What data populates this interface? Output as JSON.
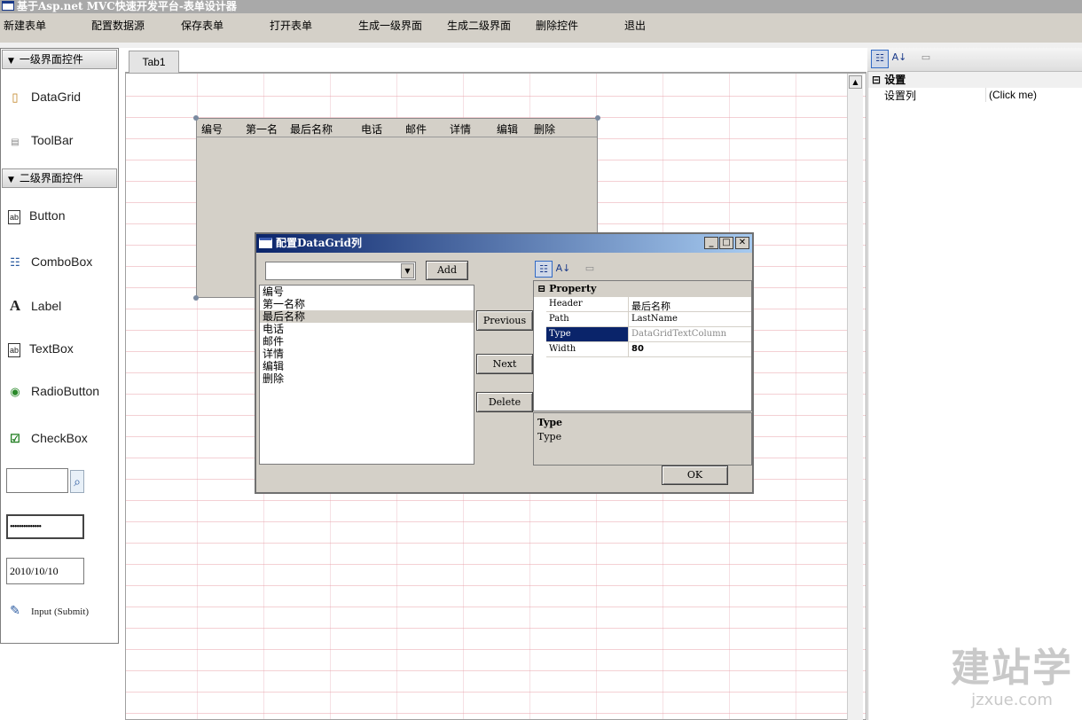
{
  "window": {
    "title": "基于Asp.net MVC快速开发平台-表单设计器"
  },
  "menu": {
    "items": [
      "新建表单",
      "配置数据源",
      "保存表单",
      "打开表单",
      "生成一级界面",
      "生成二级界面",
      "删除控件",
      "退出"
    ]
  },
  "toolbox": {
    "group1": {
      "title": "一级界面控件",
      "items": [
        "DataGrid",
        "ToolBar"
      ]
    },
    "group2": {
      "title": "二级界面控件",
      "items": [
        "Button",
        "ComboBox",
        "Label",
        "TextBox",
        "RadioButton",
        "CheckBox"
      ],
      "password_value": "••••••••••••••",
      "date_value": "2010/10/10",
      "submit_label": "Input (Submit)"
    }
  },
  "tabs": [
    "Tab1"
  ],
  "datagrid": {
    "columns": [
      "编号",
      "第一名",
      "最后名称",
      "电话",
      "邮件",
      "详情",
      "编辑",
      "删除"
    ]
  },
  "dialog": {
    "title": "配置DataGrid列",
    "add_label": "Add",
    "combo_value": "",
    "columns": [
      "编号",
      "第一名称",
      "最后名称",
      "电话",
      "邮件",
      "详情",
      "编辑",
      "删除"
    ],
    "selected_index": 2,
    "previous_label": "Previous",
    "next_label": "Next",
    "delete_label": "Delete",
    "ok_label": "OK",
    "property_category": "Property",
    "properties": [
      {
        "key": "Header",
        "value": "最后名称"
      },
      {
        "key": "Path",
        "value": "LastName"
      },
      {
        "key": "Type",
        "value": "DataGridTextColumn"
      },
      {
        "key": "Width",
        "value": "80"
      }
    ],
    "description_title": "Type",
    "description_text": "Type"
  },
  "right_panel": {
    "category": "设置",
    "rows": [
      {
        "key": "设置列",
        "value": "(Click me)"
      }
    ]
  },
  "watermark": {
    "brand": "建站学",
    "url": "jzxue.com"
  }
}
